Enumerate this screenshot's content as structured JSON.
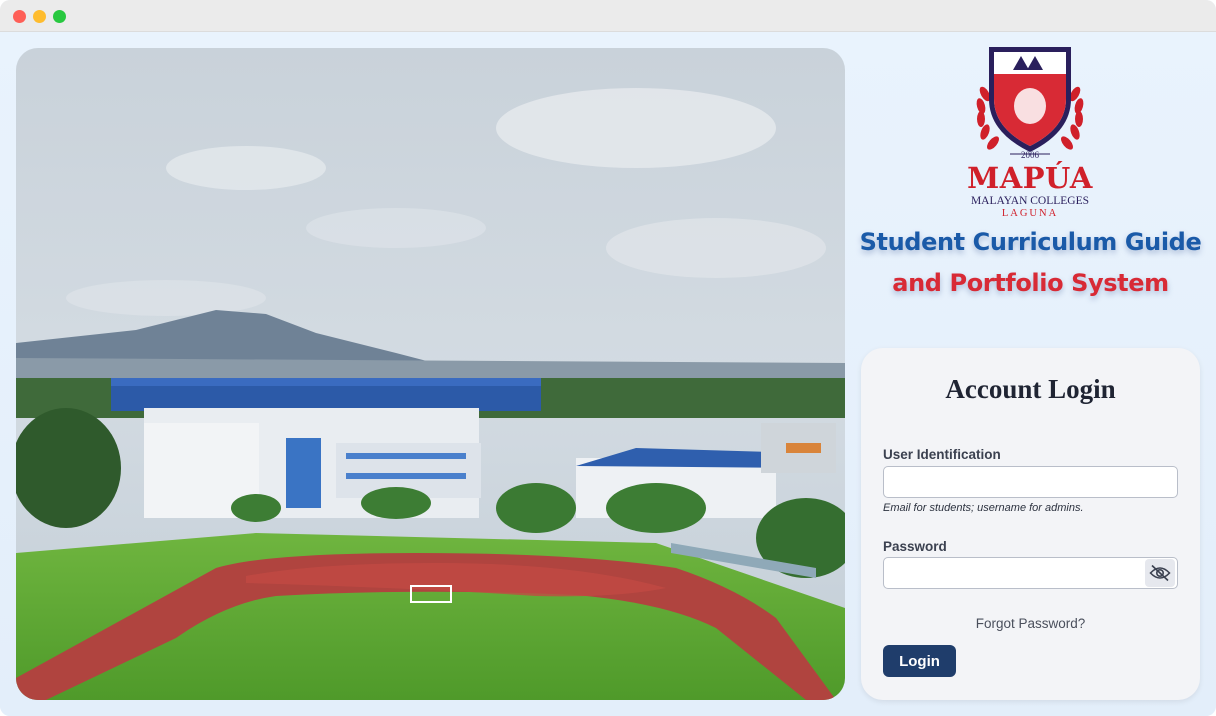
{
  "window": {
    "controls": [
      "close",
      "minimize",
      "maximize"
    ]
  },
  "hero": {
    "image": "campus-aerial-photo"
  },
  "logo": {
    "year": "2006",
    "name": "MAPÚA",
    "line2": "MALAYAN COLLEGES",
    "line3": "LAGUNA"
  },
  "system_title": {
    "line1": "Student Curriculum Guide",
    "line2": "and Portfolio System"
  },
  "login": {
    "heading": "Account Login",
    "user_label": "User Identification",
    "user_value": "",
    "user_hint": "Email for students; username for admins.",
    "password_label": "Password",
    "password_value": "",
    "toggle_icon": "eye-off-icon",
    "forgot_label": "Forgot Password?",
    "submit_label": "Login"
  },
  "colors": {
    "brand_red": "#d0202a",
    "brand_blue": "#1a5aa8",
    "button_navy": "#1f3d6b",
    "card_bg": "#f3f4f7"
  }
}
